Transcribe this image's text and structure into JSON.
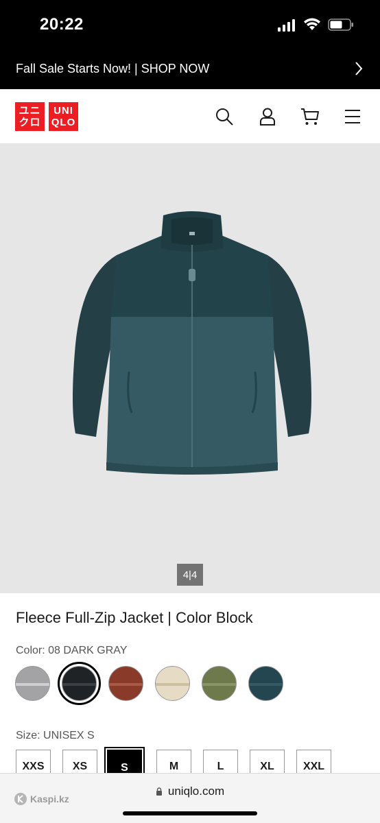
{
  "status_bar": {
    "time": "20:22"
  },
  "promo": {
    "text": "Fall Sale Starts Now! | SHOP NOW"
  },
  "header": {
    "logo_top": [
      "ユニ",
      "クロ"
    ],
    "logo_bottom": [
      "UNI",
      "QLO"
    ],
    "icons": [
      "search-icon",
      "user-icon",
      "cart-icon",
      "menu-icon"
    ]
  },
  "gallery": {
    "pager": "4|4"
  },
  "product": {
    "title": "Fleece Full-Zip Jacket | Color Block",
    "color_label": "Color: 08 DARK GRAY",
    "colors": [
      {
        "name": "light-gray",
        "hex": "#a3a3a6",
        "band": "#cfcfd1"
      },
      {
        "name": "dark-gray",
        "hex": "#1f2326",
        "band": "#3a4045",
        "selected": true
      },
      {
        "name": "brown",
        "hex": "#8a3a28",
        "band": "#a85a45"
      },
      {
        "name": "natural",
        "hex": "#e6dcc6",
        "band": "#cbbf9f"
      },
      {
        "name": "olive",
        "hex": "#6f7a4c",
        "band": "#8c9566"
      },
      {
        "name": "dark-green",
        "hex": "#244650",
        "band": "#355a66"
      }
    ],
    "size_label": "Size: UNISEX S",
    "sizes": [
      "XXS",
      "XS",
      "S",
      "M",
      "L",
      "XL",
      "XXL"
    ],
    "selected_size": "S"
  },
  "browser": {
    "url": "uniqlo.com",
    "kaspi": "Kaspi.kz"
  },
  "colors": {
    "brand": "#ed1d24",
    "gallery_bg": "#e6e6e6",
    "pager_bg": "#737373"
  }
}
